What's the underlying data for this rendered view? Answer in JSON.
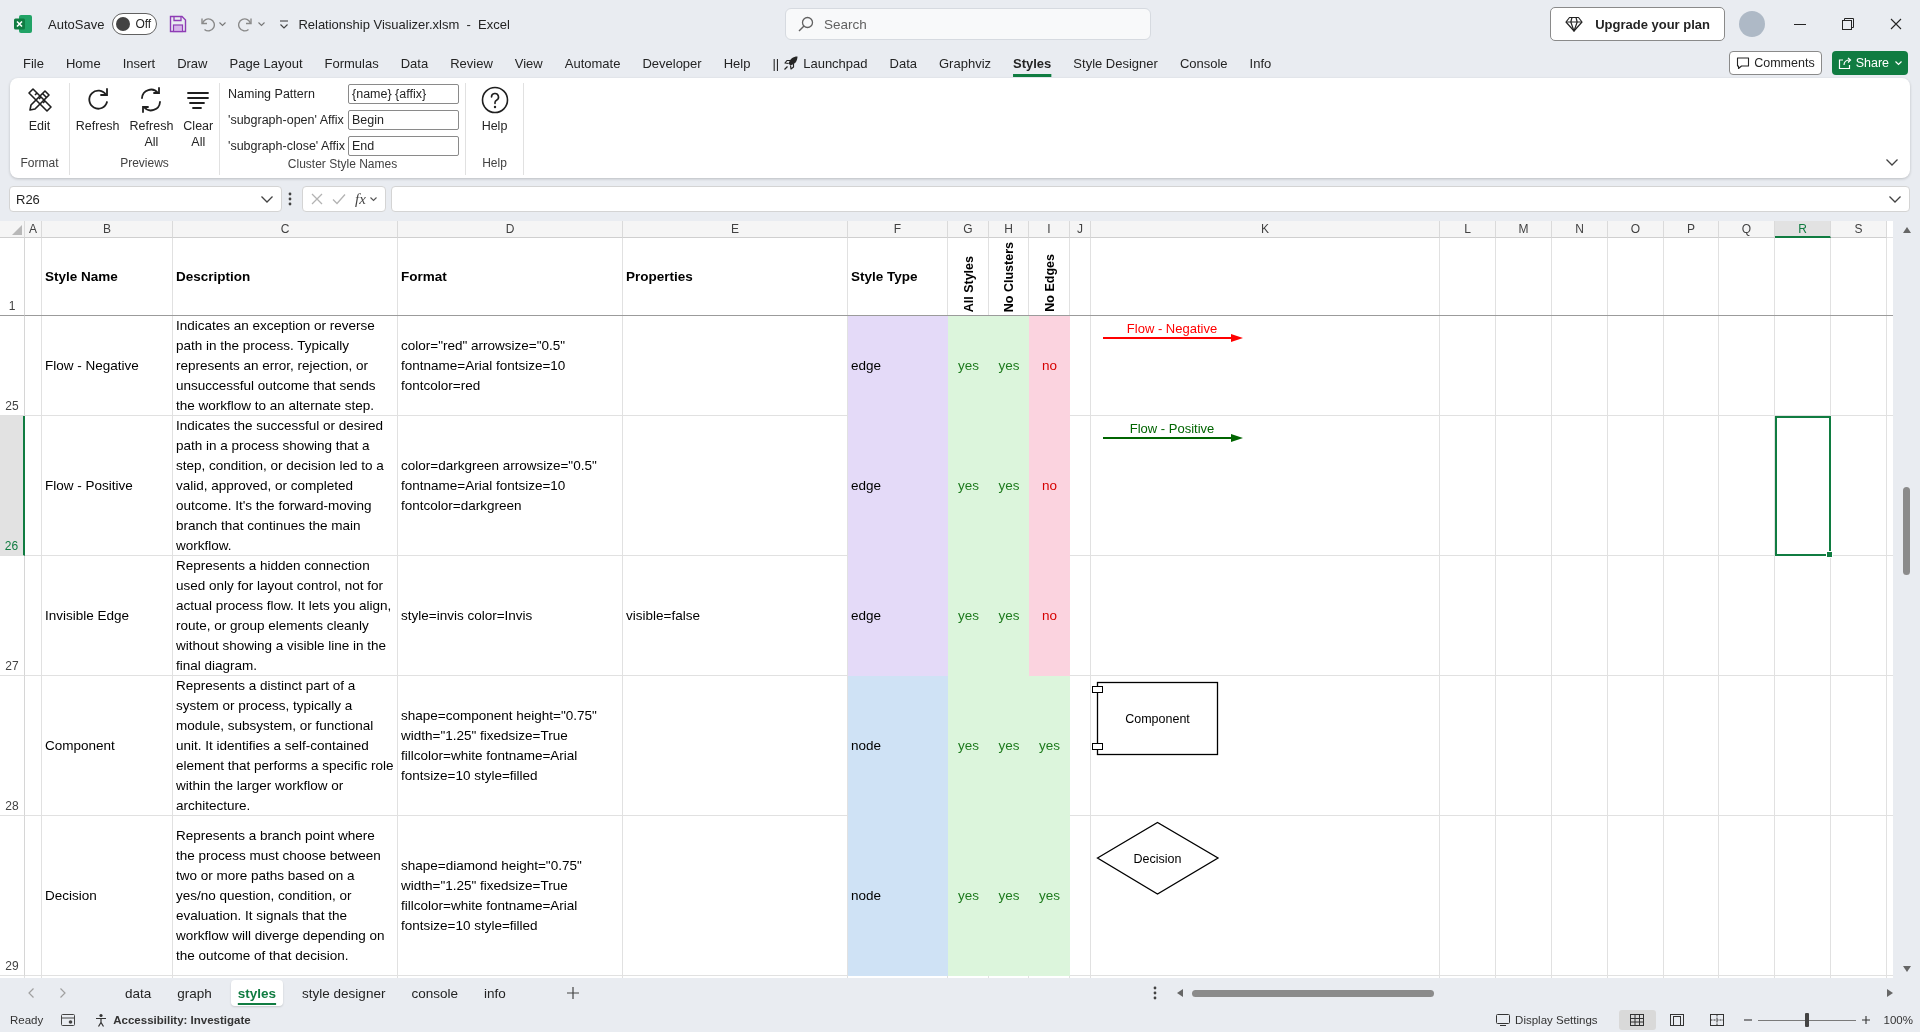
{
  "title_bar": {
    "autosave_label": "AutoSave",
    "autosave": {
      "text": "Off",
      "on": false
    },
    "title": "Relationship Visualizer.xlsm  -  Excel",
    "search": {
      "placeholder": "Search"
    },
    "upgrade_button": "Upgrade your plan"
  },
  "ribbon_tabs": [
    {
      "label": "File",
      "selected": false
    },
    {
      "label": "Home",
      "selected": false
    },
    {
      "label": "Insert",
      "selected": false
    },
    {
      "label": "Draw",
      "selected": false
    },
    {
      "label": "Page Layout",
      "selected": false
    },
    {
      "label": "Formulas",
      "selected": false
    },
    {
      "label": "Data",
      "selected": false
    },
    {
      "label": "Review",
      "selected": false
    },
    {
      "label": "View",
      "selected": false
    },
    {
      "label": "Automate",
      "selected": false
    },
    {
      "label": "Developer",
      "selected": false
    },
    {
      "label": "Help",
      "selected": false
    },
    {
      "prefix": "||",
      "label": "Launchpad",
      "selected": false
    },
    {
      "label": "Data",
      "selected": false
    },
    {
      "label": "Graphviz",
      "selected": false
    },
    {
      "label": "Styles",
      "selected": true
    },
    {
      "label": "Style Designer",
      "selected": false
    },
    {
      "label": "Console",
      "selected": false
    },
    {
      "label": "Info",
      "selected": false
    }
  ],
  "header_buttons": {
    "comments": "Comments",
    "share": "Share"
  },
  "ribbon": {
    "groups": [
      {
        "label": "Format",
        "items": [
          {
            "kind": "button",
            "label": "Edit"
          }
        ]
      },
      {
        "label": "Previews",
        "items": [
          {
            "kind": "button",
            "label": "Refresh"
          },
          {
            "kind": "button",
            "label": "Refresh All"
          },
          {
            "kind": "button",
            "label": "Clear All"
          }
        ]
      },
      {
        "label": "Cluster Style Names",
        "items": [
          {
            "kind": "field",
            "label": "Naming Pattern",
            "value": "{name} {affix}"
          },
          {
            "kind": "field",
            "label": "'subgraph-open' Affix",
            "value": "Begin"
          },
          {
            "kind": "field",
            "label": "'subgraph-close' Affix",
            "value": "End"
          }
        ]
      },
      {
        "label": "Help",
        "items": [
          {
            "kind": "button",
            "label": "Help"
          }
        ]
      }
    ]
  },
  "formula_bar": {
    "name_box": "R26",
    "function_button": "fx"
  },
  "sheet": {
    "columns": [
      {
        "letter": "A",
        "selected": false
      },
      {
        "letter": "B",
        "selected": false
      },
      {
        "letter": "C",
        "selected": false
      },
      {
        "letter": "D",
        "selected": false
      },
      {
        "letter": "E",
        "selected": false
      },
      {
        "letter": "F",
        "selected": false
      },
      {
        "letter": "G",
        "selected": false
      },
      {
        "letter": "H",
        "selected": false
      },
      {
        "letter": "I",
        "selected": false
      },
      {
        "letter": "J",
        "selected": false
      },
      {
        "letter": "K",
        "selected": false
      },
      {
        "letter": "L",
        "selected": false
      },
      {
        "letter": "M",
        "selected": false
      },
      {
        "letter": "N",
        "selected": false
      },
      {
        "letter": "O",
        "selected": false
      },
      {
        "letter": "P",
        "selected": false
      },
      {
        "letter": "Q",
        "selected": false
      },
      {
        "letter": "R",
        "selected": true
      },
      {
        "letter": "S",
        "selected": false
      }
    ],
    "header_row": {
      "number": "1",
      "selected": false,
      "style_name": "Style Name",
      "description": "Description",
      "format": "Format",
      "properties": "Properties",
      "style_type": "Style Type",
      "all_styles": "All Styles",
      "no_clusters": "No Clusters",
      "no_edges": "No Edges"
    },
    "rows": [
      {
        "number": "25",
        "selected": false,
        "style_name": "Flow - Negative",
        "description": "Indicates an exception or reverse path in the process. Typically represents an error, rejection, or unsuccessful outcome that sends the workflow to an alternate step.",
        "format": "color=\"red\" arrowsize=\"0.5\" fontname=Arial fontsize=10 fontcolor=red",
        "style_type": {
          "text": "edge",
          "color": "#e4daf8"
        },
        "all_styles": {
          "text": "yes",
          "enabled": true
        },
        "no_clusters": {
          "text": "yes",
          "enabled": true
        },
        "no_edges": {
          "text": "no",
          "enabled": false
        },
        "preview": {
          "kind": "edge",
          "label": "Flow - Negative",
          "color": "#ff0000"
        }
      },
      {
        "number": "26",
        "selected": true,
        "style_name": "Flow - Positive",
        "description": "Indicates the successful or desired path in a process showing that a step, condition, or decision led to a valid, approved, or completed outcome. It's the forward-moving branch that continues the main workflow.",
        "format": "color=darkgreen arrowsize=\"0.5\" fontname=Arial fontsize=10 fontcolor=darkgreen",
        "style_type": {
          "text": "edge",
          "color": "#e4daf8"
        },
        "all_styles": {
          "text": "yes",
          "enabled": true
        },
        "no_clusters": {
          "text": "yes",
          "enabled": true
        },
        "no_edges": {
          "text": "no",
          "enabled": false
        },
        "preview": {
          "kind": "edge",
          "label": "Flow - Positive",
          "color": "#006400"
        }
      },
      {
        "number": "27",
        "selected": false,
        "style_name": "Invisible Edge",
        "description": "Represents a hidden connection used only for layout control, not for actual process flow. It lets you align, route, or group elements cleanly without showing a visible line in the final diagram.",
        "format": "style=invis color=Invis",
        "properties": "visible=false",
        "style_type": {
          "text": "edge",
          "color": "#e4daf8"
        },
        "all_styles": {
          "text": "yes",
          "enabled": true
        },
        "no_clusters": {
          "text": "yes",
          "enabled": true
        },
        "no_edges": {
          "text": "no",
          "enabled": false
        }
      },
      {
        "number": "28",
        "selected": false,
        "style_name": "Component",
        "description": "Represents a distinct part of a system or process, typically a module, subsystem, or functional unit. It identifies a self-contained element that performs a specific role within the larger workflow or architecture.",
        "format": "shape=component height=\"0.75\" width=\"1.25\" fixedsize=True fillcolor=white fontname=Arial fontsize=10 style=filled",
        "style_type": {
          "text": "node",
          "color": "#cfe2f5"
        },
        "all_styles": {
          "text": "yes",
          "enabled": true
        },
        "no_clusters": {
          "text": "yes",
          "enabled": true
        },
        "no_edges": {
          "text": "yes",
          "enabled": true
        },
        "preview": {
          "kind": "component",
          "label": "Component"
        }
      },
      {
        "number": "29",
        "selected": false,
        "style_name": "Decision",
        "description": "Represents a branch point where the process must choose between two or more paths based on a yes/no question, condition, or evaluation. It signals that the workflow will diverge depending on the outcome of that decision.",
        "format": "shape=diamond height=\"0.75\" width=\"1.25\" fixedsize=True fillcolor=white fontname=Arial fontsize=10 style=filled",
        "style_type": {
          "text": "node",
          "color": "#cfe2f5"
        },
        "all_styles": {
          "text": "yes",
          "enabled": true
        },
        "no_clusters": {
          "text": "yes",
          "enabled": true
        },
        "no_edges": {
          "text": "yes",
          "enabled": true
        },
        "preview": {
          "kind": "diamond",
          "label": "Decision"
        }
      }
    ]
  },
  "sheet_tabs": [
    {
      "label": "data",
      "selected": false
    },
    {
      "label": "graph",
      "selected": false
    },
    {
      "label": "styles",
      "selected": true
    },
    {
      "label": "style designer",
      "selected": false
    },
    {
      "label": "console",
      "selected": false
    },
    {
      "label": "info",
      "selected": false
    }
  ],
  "status_bar": {
    "status": "Ready",
    "accessibility": "Accessibility: Investigate",
    "display_settings": "Display Settings",
    "view_buttons": [
      {
        "selected": true
      },
      {
        "selected": false
      },
      {
        "selected": false
      }
    ],
    "zoom": {
      "level": 0.5,
      "text": "100%"
    }
  }
}
